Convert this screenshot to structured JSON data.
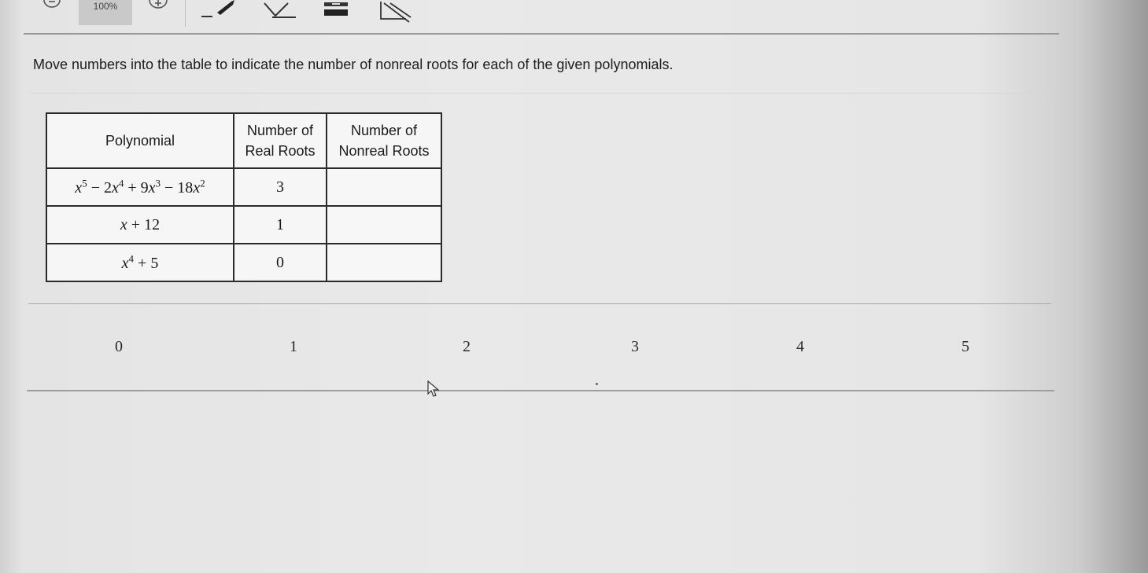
{
  "toolbar": {
    "zoom_label": "100%",
    "icons": [
      "zoom-out-icon",
      "zoom-in-icon",
      "pencil-icon",
      "eraser-icon",
      "line-reader-icon",
      "answer-eliminator-icon"
    ]
  },
  "question": {
    "prompt": "Move numbers into the table to indicate the number of nonreal roots for each of the given polynomials."
  },
  "table": {
    "headers": {
      "polynomial": "Polynomial",
      "real_line1": "Number of",
      "real_line2": "Real Roots",
      "nonreal_line1": "Number of",
      "nonreal_line2": "Nonreal Roots"
    },
    "rows": [
      {
        "polynomial": "x^5 − 2x^4 + 9x^3 − 18x^2",
        "real_roots": "3",
        "nonreal_roots": ""
      },
      {
        "polynomial": "x + 12",
        "real_roots": "1",
        "nonreal_roots": ""
      },
      {
        "polynomial": "x^4 + 5",
        "real_roots": "0",
        "nonreal_roots": ""
      }
    ]
  },
  "answer_choices": [
    "0",
    "1",
    "2",
    "3",
    "4",
    "5"
  ],
  "colors": {
    "background": "#e9e9e9",
    "table_border": "#2a2a2a",
    "divider": "#9e9e9e"
  }
}
